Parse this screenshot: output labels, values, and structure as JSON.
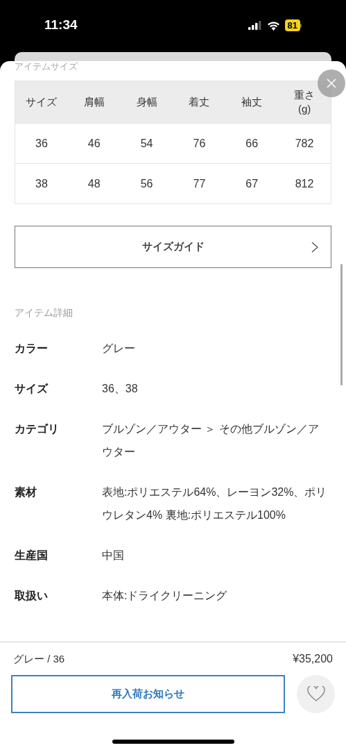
{
  "status_bar": {
    "time": "11:34",
    "battery": "81"
  },
  "size_table": {
    "title": "アイテムサイズ",
    "columns": [
      "サイズ",
      "肩幅",
      "身幅",
      "着丈",
      "袖丈",
      "重さ\n(g)"
    ],
    "rows": [
      [
        "36",
        "46",
        "54",
        "76",
        "66",
        "782"
      ],
      [
        "38",
        "48",
        "56",
        "77",
        "67",
        "812"
      ]
    ]
  },
  "size_guide_button": {
    "label": "サイズガイド"
  },
  "details": {
    "title": "アイテム詳細",
    "rows": [
      {
        "label": "カラー",
        "value": "グレー"
      },
      {
        "label": "サイズ",
        "value": "36、38"
      },
      {
        "label": "カテゴリ",
        "value": "ブルゾン／アウター ＞ その他ブルゾン／アウター"
      },
      {
        "label": "素材",
        "value": "表地:ポリエステル64%、レーヨン32%、ポリウレタン4% 裏地:ポリエステル100%"
      },
      {
        "label": "生産国",
        "value": "中国"
      },
      {
        "label": "取扱い",
        "value": "本体:ドライクリーニング"
      }
    ]
  },
  "footer": {
    "selection": "グレー / 36",
    "price": "¥35,200",
    "restock_button": "再入荷お知らせ"
  }
}
